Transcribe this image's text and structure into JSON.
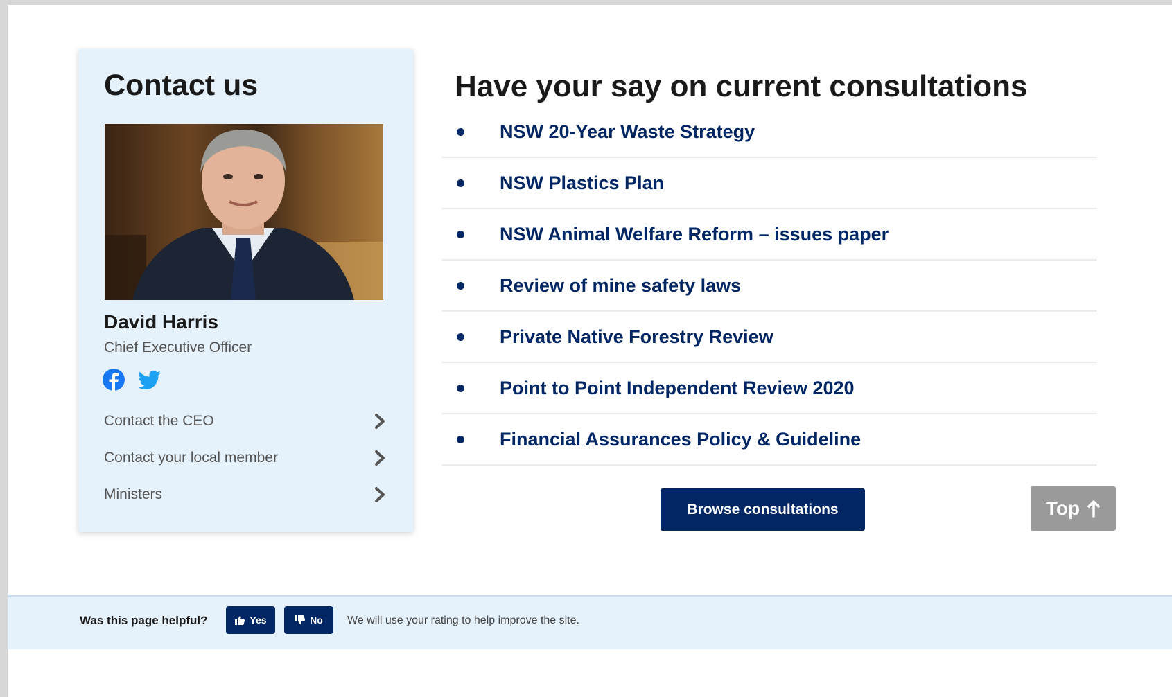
{
  "contact": {
    "title": "Contact us",
    "name": "David Harris",
    "role": "Chief Executive Officer",
    "links": [
      {
        "label": "Contact the CEO"
      },
      {
        "label": "Contact your local member"
      },
      {
        "label": "Ministers"
      }
    ]
  },
  "consultations": {
    "title": "Have your say on current consultations",
    "items": [
      {
        "label": "NSW 20-Year Waste Strategy"
      },
      {
        "label": "NSW Plastics Plan"
      },
      {
        "label": "NSW Animal Welfare Reform – issues paper"
      },
      {
        "label": "Review of mine safety laws"
      },
      {
        "label": "Private Native Forestry Review"
      },
      {
        "label": "Point to Point Independent Review 2020"
      },
      {
        "label": "Financial Assurances Policy & Guideline"
      }
    ],
    "browse_label": "Browse consultations"
  },
  "top_label": "Top",
  "feedback": {
    "question": "Was this page helpful?",
    "yes_label": "Yes",
    "no_label": "No",
    "note": "We will use your rating to help improve the site."
  },
  "colors": {
    "navy": "#002664",
    "card_bg": "#e5f2fc",
    "facebook": "#1877f2",
    "twitter": "#1da1f2",
    "top_button": "#9a9a9a"
  },
  "icons": [
    "facebook-icon",
    "twitter-icon",
    "chevron-right-icon",
    "arrow-up-icon",
    "thumbs-up-icon",
    "thumbs-down-icon"
  ]
}
